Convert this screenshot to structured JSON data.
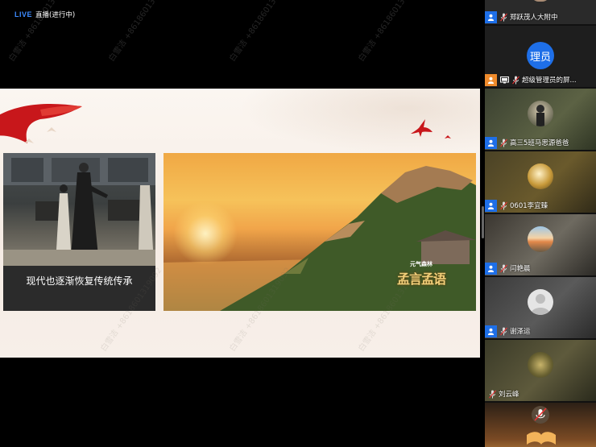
{
  "header": {
    "live_tag": "LIVE",
    "status": "直播(进行中)"
  },
  "slide": {
    "left_caption": "现代也逐渐恢复传统传承",
    "logo_top": "元气森林",
    "logo_main": "孟言孟语"
  },
  "watermark": {
    "name": "白雪洁",
    "phone": "+8618601319092"
  },
  "participants": [
    {
      "name": "郑跃茂人大附中",
      "badge": "user-icon",
      "mic": "mic-muted-icon"
    },
    {
      "name": "超级管理员的屏...",
      "badge": "user-icon",
      "role_avatar": "理员",
      "extra_icon": "screen-share-icon"
    },
    {
      "name": "高三5班马思源爸爸",
      "badge": "user-icon",
      "mic": "mic-muted-icon"
    },
    {
      "name": "0601李宜臻",
      "badge": "user-icon",
      "mic": "mic-muted-icon"
    },
    {
      "name": "闫艳晨",
      "badge": "user-icon",
      "mic": "mic-muted-icon"
    },
    {
      "name": "谢泽运",
      "badge": "user-icon",
      "mic": "mic-muted-icon"
    },
    {
      "name": "刘云峰",
      "badge": "",
      "mic": "mic-muted-icon"
    },
    {
      "name": "",
      "badge": "",
      "mic": "mic-muted-icon"
    }
  ],
  "colors": {
    "live_blue": "#3d8bff",
    "badge_blue": "#1e6fe8",
    "badge_orange": "#ef8b2c",
    "slide_bg": "#f8efe8"
  }
}
